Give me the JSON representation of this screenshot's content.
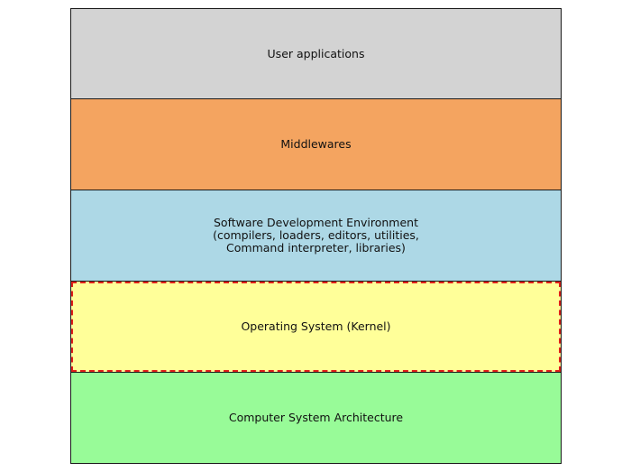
{
  "diagram": {
    "layers": [
      {
        "label": "User applications",
        "color": "#d3d3d3",
        "highlighted": false
      },
      {
        "label": "Middlewares",
        "color": "#f4a460",
        "highlighted": false
      },
      {
        "label": "Software Development Environment\n(compilers, loaders, editors, utilities,\nCommand interpreter, libraries)",
        "color": "#add8e6",
        "highlighted": false
      },
      {
        "label": "Operating System (Kernel)",
        "color": "#ffff99",
        "highlighted": true
      },
      {
        "label": "Computer System Architecture",
        "color": "#98fb98",
        "highlighted": false
      }
    ],
    "highlight_color": "#e0201a",
    "border_color": "#1a1a1a"
  }
}
